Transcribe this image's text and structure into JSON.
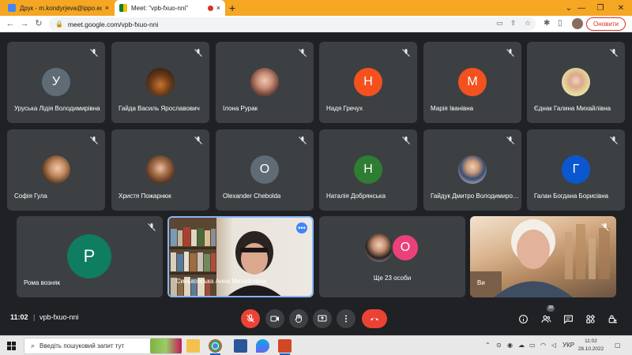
{
  "browser": {
    "tabs": [
      {
        "title": "Друк - m.kondyrjeva@ippo.edu",
        "close": "×"
      },
      {
        "title": "Meet: \"vpb-fxuo-nni\"",
        "close": "×"
      }
    ],
    "new_tab": "+",
    "url": "meet.google.com/vpb-fxuo-nni",
    "update_label": "Оновити",
    "window_controls": {
      "minimize": "—",
      "restore": "❐",
      "close": "✕"
    }
  },
  "meet": {
    "participants": [
      {
        "name": "Уруська Лідія Володимирівна",
        "initial": "У",
        "color": "#5f6b75"
      },
      {
        "name": "Гайда Василь Ярославович"
      },
      {
        "name": "Ілона Рурак"
      },
      {
        "name": "Надя Гречух",
        "initial": "Н",
        "color": "#f4511e"
      },
      {
        "name": "Марія Іванівна",
        "initial": "М",
        "color": "#f4511e"
      },
      {
        "name": "Єднак Галина Михайлівна"
      },
      {
        "name": "Софія Гула"
      },
      {
        "name": "Христя Пожарнюк"
      },
      {
        "name": "Olexander Chebolda",
        "initial": "O",
        "color": "#5f6b75"
      },
      {
        "name": "Наталія Добрянська",
        "initial": "Н",
        "color": "#2e7d32"
      },
      {
        "name": "Гайдук Дмитро Володимирович"
      },
      {
        "name": "Галан Богдана Борисівна",
        "initial": "Г",
        "color": "#0b57d0"
      },
      {
        "name": "Рома возняк",
        "initial": "Р",
        "color": "#0f7d5f"
      },
      {
        "name": "Синьковська Анна Михайлівна"
      },
      {
        "name": "Ще 23 особи",
        "initial": "О",
        "color": "#ec407a"
      },
      {
        "name": "Ви"
      }
    ],
    "more_options": "•••",
    "time": "11:02",
    "separator": "|",
    "meeting_code": "vpb-fxuo-nni",
    "people_count": "38"
  },
  "taskbar": {
    "search_placeholder": "Введіть пошуковий запит тут",
    "language": "УКР",
    "clock_time": "11:02",
    "clock_date": "28.10.2022"
  }
}
